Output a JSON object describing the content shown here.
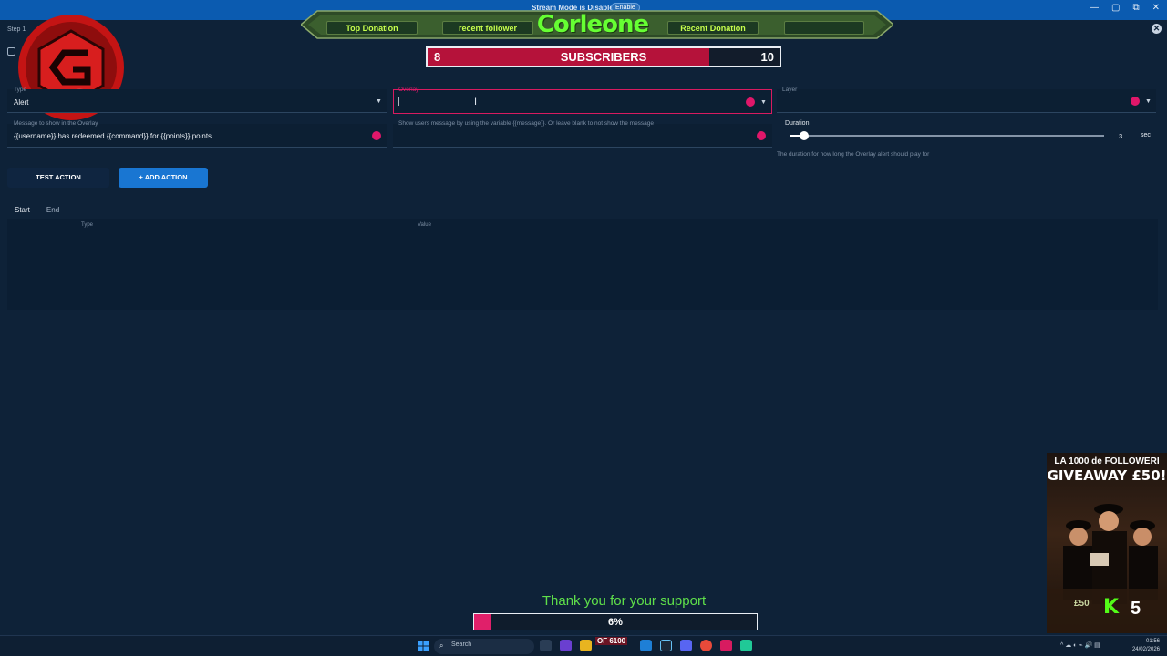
{
  "window": {
    "stream_mode": "Stream Mode is Disabled",
    "enable_label": "Enable",
    "controls": [
      "—",
      "▢",
      "⧉",
      "✕"
    ],
    "close_icon": "✕"
  },
  "overlay_banner": {
    "tabs": [
      "Top Donation",
      "recent follower",
      "Recent Donation",
      ""
    ],
    "channel": "Corleone"
  },
  "subscribers": {
    "current": "8",
    "label": "SUBSCRIBERS",
    "goal": "10",
    "progress": 0.8
  },
  "wizard": {
    "step_label": "Step 1"
  },
  "form": {
    "type": {
      "label": "Type",
      "value": "Alert"
    },
    "overlay": {
      "label": "Overlay",
      "value": ""
    },
    "layer": {
      "label": "Layer",
      "value": ""
    },
    "message": {
      "label": "Message to show in the Overlay",
      "value": "{{username}} has redeemed {{command}} for {{points}} points"
    },
    "message_hint": "Show users message by using the variable {{message}}. Or leave blank to not show the message",
    "duration": {
      "label": "Duration",
      "value": "3",
      "unit": "sec",
      "hint": "The duration for how long the Overlay alert should play for"
    }
  },
  "actions": {
    "test_label": "TEST ACTION",
    "add_label": "ADD ACTION",
    "add_icon": "+"
  },
  "tabs": [
    "Start",
    "End"
  ],
  "table": {
    "columns": [
      "Type",
      "Value"
    ]
  },
  "giveaway": {
    "line1": "LA 1000 de FOLLOWERI",
    "line2": "GIVEAWAY £50!",
    "money": "£50",
    "brand_letter": "K",
    "number": "5"
  },
  "support": {
    "thanks": "Thank you for your support",
    "progress_label": "6%",
    "progress": 0.06
  },
  "taskbar": {
    "search_placeholder": "Search",
    "game_badge": "OF 6100",
    "time": "01:56",
    "date": "24/02/2026",
    "tray": "^  ☁  ◐  ⌁  🔊  ▤"
  },
  "colors": {
    "accent": "#d81b60",
    "primary_button": "#1976d2",
    "banner_green": "#66ff33",
    "background": "#0e2238"
  }
}
